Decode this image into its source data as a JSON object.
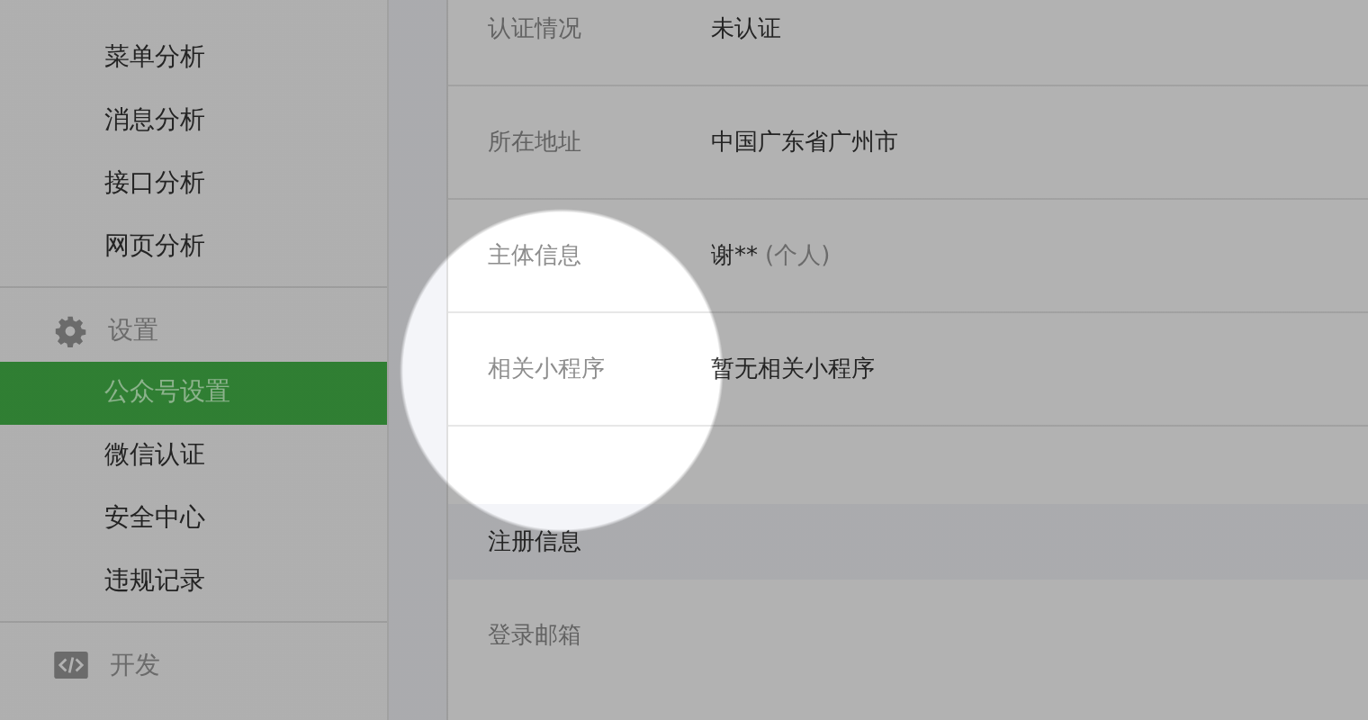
{
  "sidebar": {
    "groups": [
      {
        "items": [
          {
            "label": "菜单分析",
            "selected": false
          },
          {
            "label": "消息分析",
            "selected": false
          },
          {
            "label": "接口分析",
            "selected": false
          },
          {
            "label": "网页分析",
            "selected": false
          }
        ]
      },
      {
        "title": "设置",
        "kind": "gear",
        "items": [
          {
            "label": "公众号设置",
            "selected": true
          },
          {
            "label": "微信认证",
            "selected": false
          },
          {
            "label": "安全中心",
            "selected": false
          },
          {
            "label": "违规记录",
            "selected": false
          }
        ]
      },
      {
        "title": "开发",
        "kind": "code"
      }
    ]
  },
  "sections": [
    {
      "rows": [
        {
          "label": "认证情况",
          "value": "未认证"
        },
        {
          "label": "所在地址",
          "value": "中国广东省广州市"
        },
        {
          "label": "主体信息",
          "value": "谢**",
          "note": "(个人)"
        },
        {
          "label": "相关小程序",
          "value": "暂无相关小程序"
        }
      ]
    },
    {
      "title": "注册信息",
      "rows": [
        {
          "label": "登录邮箱"
        }
      ]
    }
  ]
}
